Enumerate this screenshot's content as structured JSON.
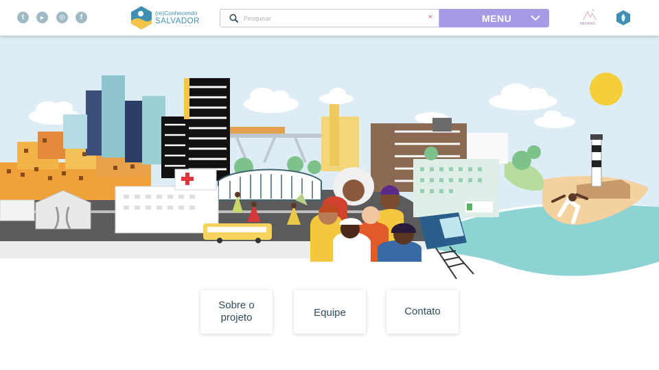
{
  "header": {
    "social": [
      {
        "name": "tumblr",
        "glyph": "t"
      },
      {
        "name": "youtube",
        "glyph": "▶"
      },
      {
        "name": "instagram",
        "glyph": "◎"
      },
      {
        "name": "facebook",
        "glyph": "f"
      }
    ],
    "logo": {
      "small": "(re)Conhecendo",
      "big": "SALVADOR"
    },
    "search": {
      "placeholder": "Pesquisar",
      "clear": "×"
    },
    "menu": {
      "label": "MENU"
    },
    "partners": [
      {
        "name": "MENINAS",
        "label": "MENINAS"
      },
      {
        "name": "flame-partner"
      }
    ]
  },
  "cards": [
    {
      "label": "Sobre o projeto"
    },
    {
      "label": "Equipe"
    },
    {
      "label": "Contato"
    }
  ],
  "colors": {
    "menu": "#a89be6",
    "social": "#9fbac4",
    "text": "#2f4a5e",
    "sky": "#dff0f7",
    "sea": "#8dd3d4"
  }
}
